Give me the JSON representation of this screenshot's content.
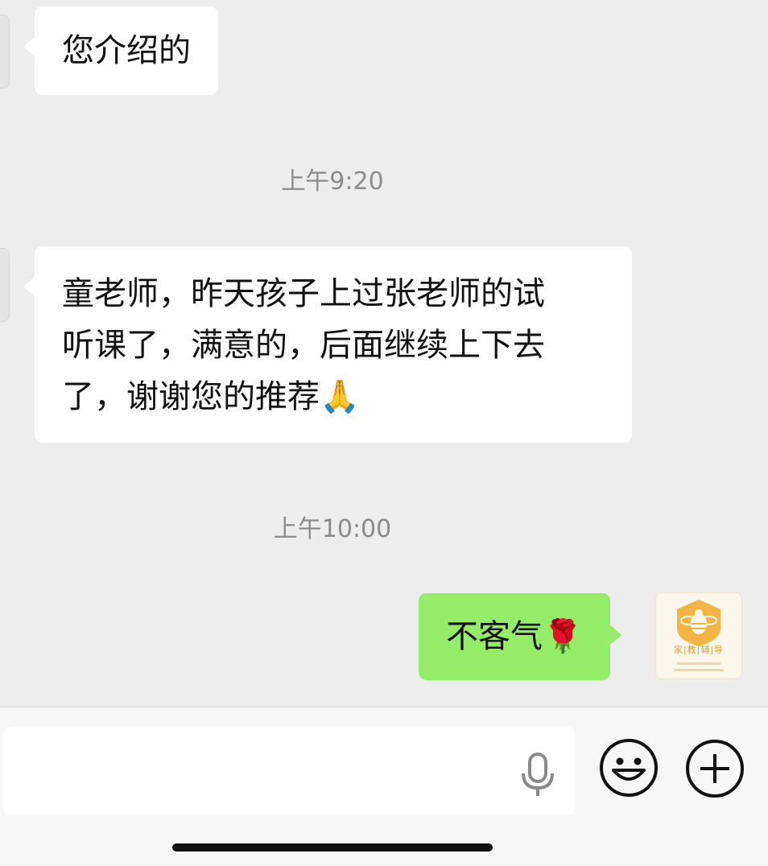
{
  "messages": [
    {
      "side": "left",
      "text": "您介绍的"
    },
    {
      "side": "left",
      "lines": [
        "童老师，昨天孩子上过张老师的试",
        "听课了，满意的，后面继续上下去",
        "了，谢谢您的推荐"
      ],
      "emoji": "🙏"
    },
    {
      "side": "right",
      "text": "不客气",
      "emoji": "🌹"
    }
  ],
  "timestamps": [
    "上午9:20",
    "上午10:00"
  ],
  "avatar_right": {
    "caption": "家|教|辅|导"
  },
  "input_bar": {
    "value": "",
    "icons": [
      "microphone-icon",
      "smiley-icon",
      "plus-icon"
    ]
  },
  "colors": {
    "background": "#ededed",
    "own_bubble": "#95ec69",
    "other_bubble": "#ffffff",
    "timestamp": "#8c8c8c"
  }
}
